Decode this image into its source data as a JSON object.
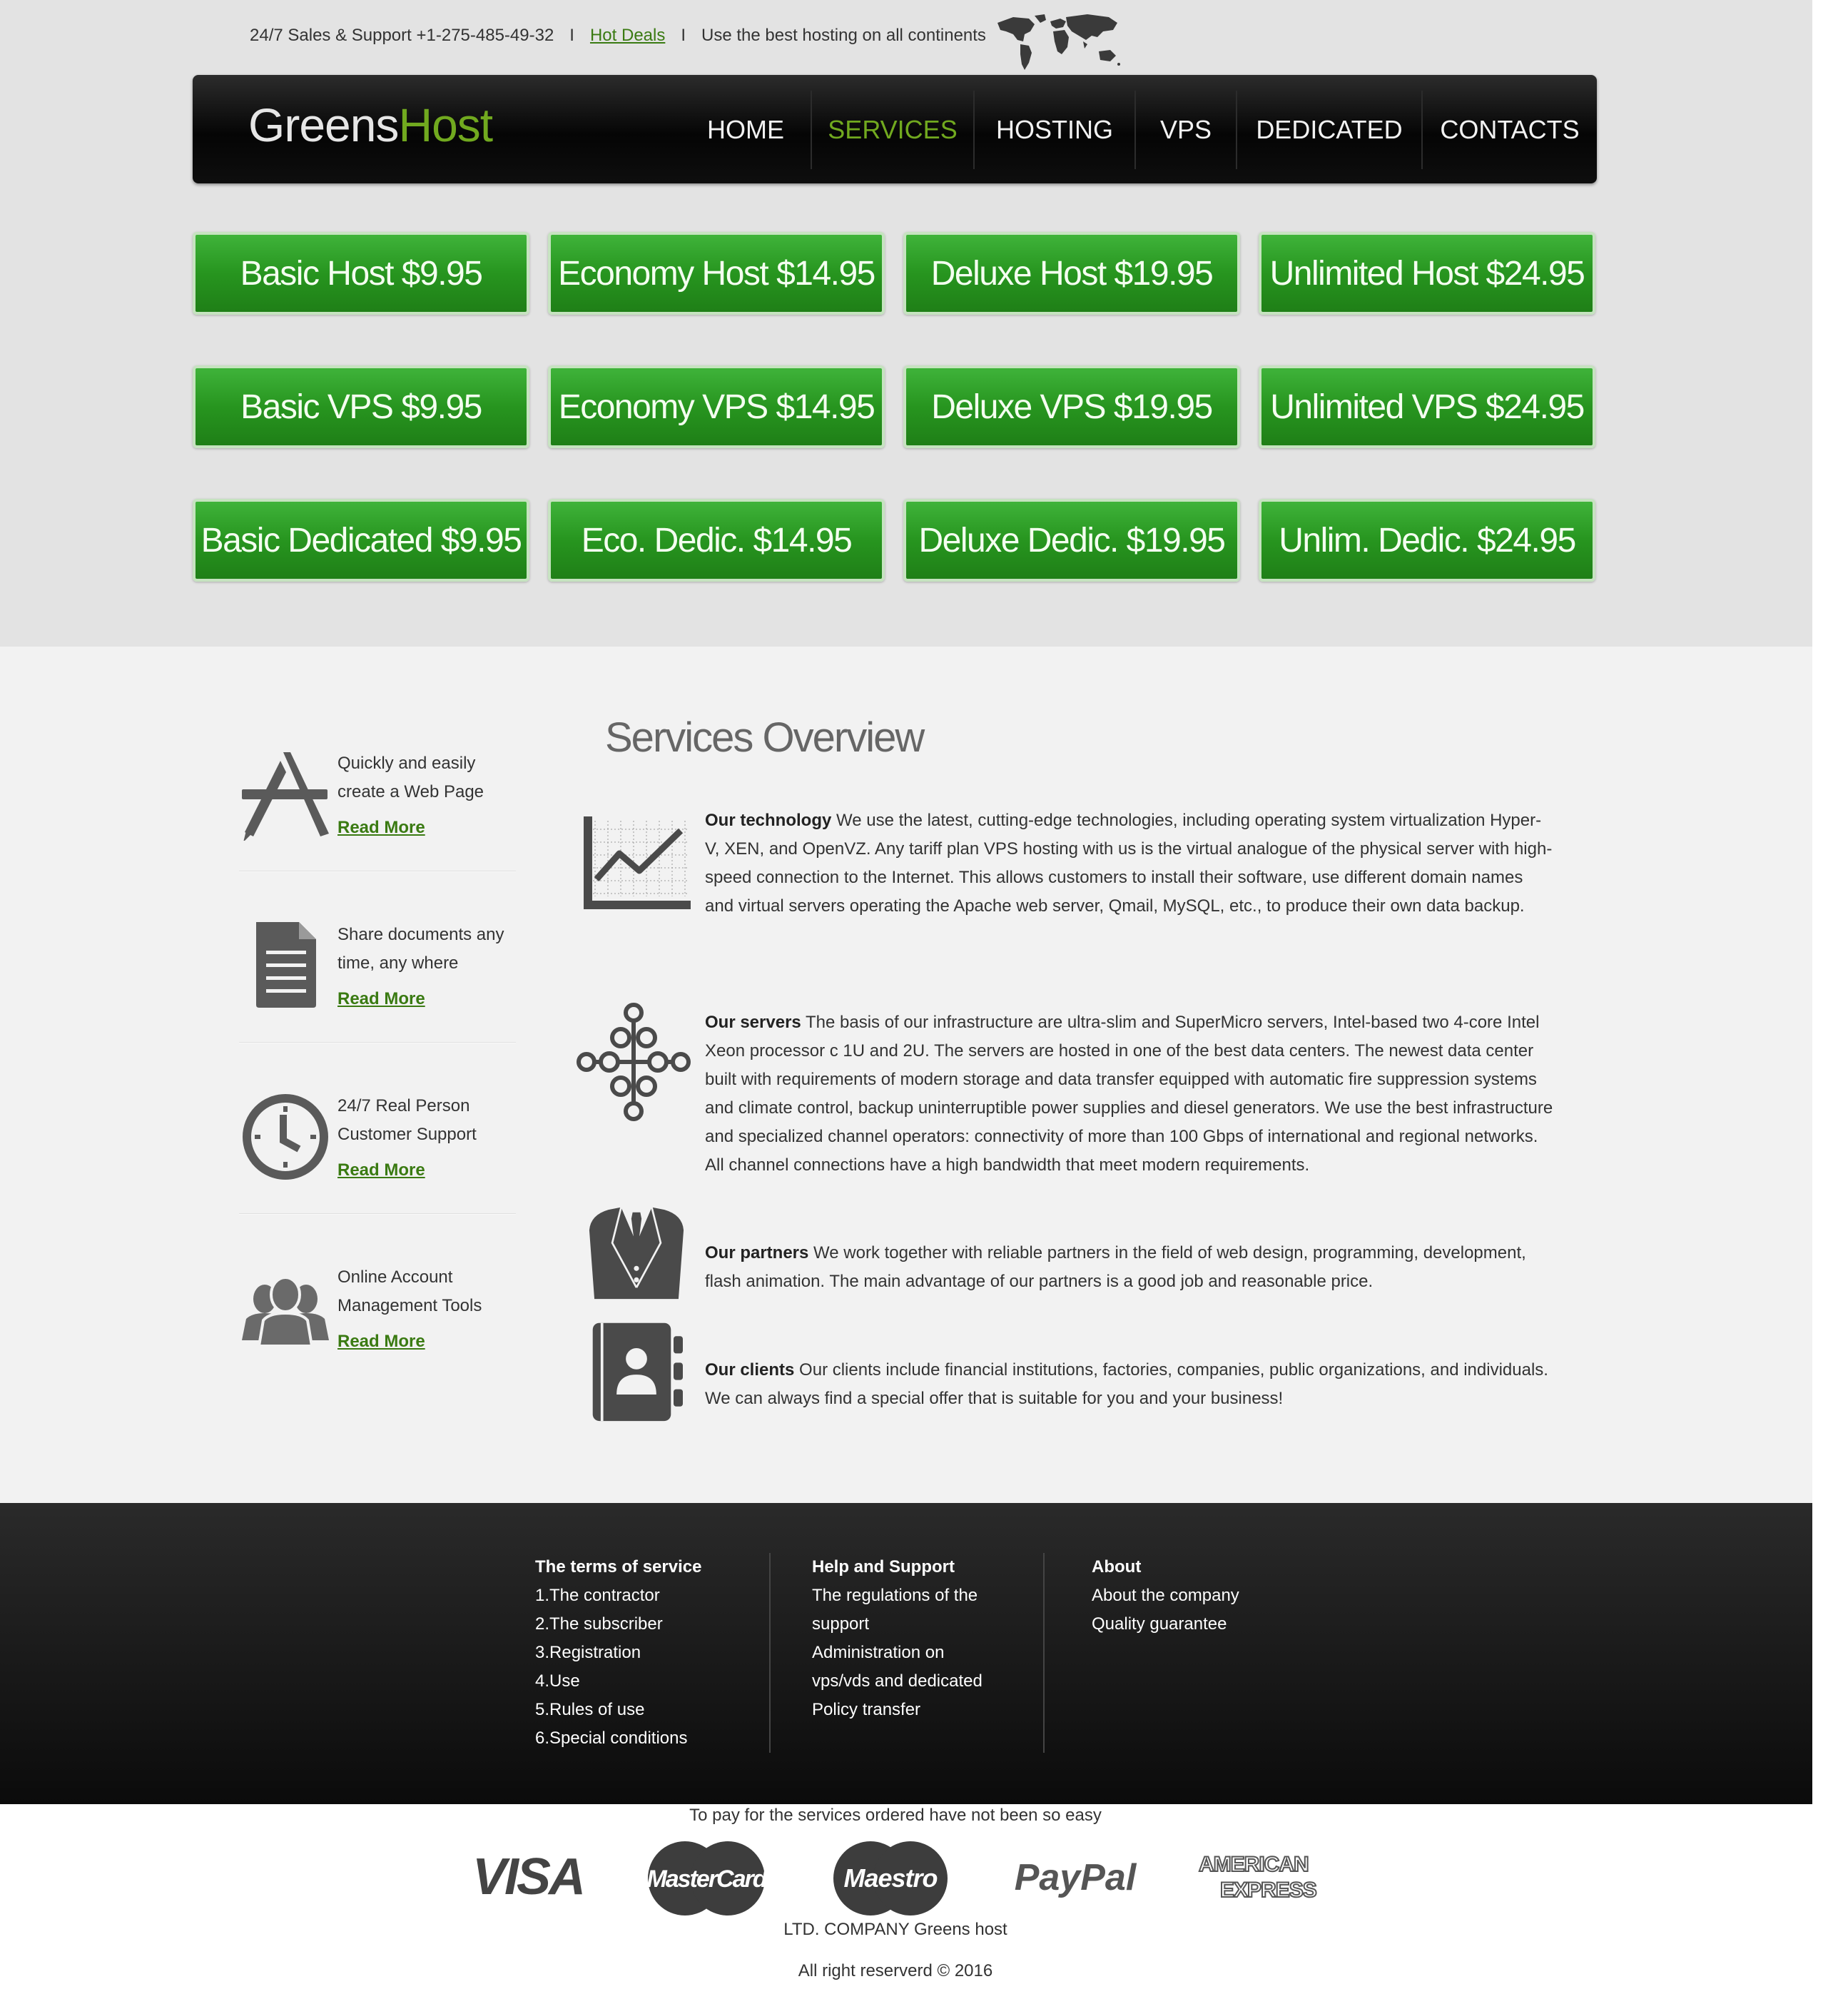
{
  "topbar": {
    "support": "24/7 Sales & Support +1-275-485-49-32",
    "sep1": "I",
    "hot_deals": "Hot Deals",
    "sep2": "I",
    "tagline": "Use the best hosting on all continents"
  },
  "logo": {
    "part1": "Greens",
    "part2": "Host"
  },
  "nav": {
    "items": [
      "HOME",
      "SERVICES",
      "HOSTING",
      "VPS",
      "DEDICATED",
      "CONTACTS"
    ],
    "active": "SERVICES"
  },
  "plans": [
    [
      "Basic Host $9.95",
      "Economy Host $14.95",
      "Deluxe Host $19.95",
      "Unlimited Host $24.95"
    ],
    [
      "Basic VPS $9.95",
      "Economy VPS $14.95",
      "Deluxe VPS $19.95",
      "Unlimited VPS $24.95"
    ],
    [
      "Basic Dedicated $9.95",
      "Eco. Dedic. $14.95",
      "Deluxe Dedic. $19.95",
      "Unlim. Dedic. $24.95"
    ]
  ],
  "features": [
    {
      "icon": "app-store-icon",
      "text": "Quickly and easily create a Web Page",
      "link": "Read More"
    },
    {
      "icon": "document-icon",
      "text": "Share documents any time, any where",
      "link": "Read More"
    },
    {
      "icon": "clock-icon",
      "text": "24/7 Real Person Customer Support",
      "link": "Read More"
    },
    {
      "icon": "users-icon",
      "text": "Online Account Management Tools",
      "link": "Read More"
    }
  ],
  "overview": {
    "title": "Services Overview",
    "blocks": [
      {
        "icon": "chart-icon",
        "heading": "Our technology",
        "text": "We use the latest, cutting-edge technologies, including operating system virtualization Hyper-V, XEN, and OpenVZ. Any tariff plan VPS hosting with us is the virtual analogue of the physical server with high-speed connection to the Internet. This allows customers to install their software, use different domain names and virtual servers operating the Apache web server, Qmail, MySQL, etc., to produce their own data backup."
      },
      {
        "icon": "network-icon",
        "heading": "Our servers",
        "text": "The basis of our infrastructure are ultra-slim and SuperMicro servers, Intel-based two 4-core Intel Xeon processor c 1U and 2U. The servers are hosted in one of the best data centers. The newest data center built with requirements of modern storage and data transfer equipped with automatic fire suppression systems and climate control, backup uninterruptible power supplies and diesel generators. We use the best infrastructure and specialized channel operators: connectivity of more than 100 Gbps of international and regional networks. All channel connections have a high bandwidth that meet modern requirements."
      },
      {
        "icon": "suit-icon",
        "heading": "Our partners",
        "text": "We work together with reliable partners in the field of web design, programming, development, flash animation. The main advantage of our partners is a good job and reasonable price."
      },
      {
        "icon": "contacts-book-icon",
        "heading": "Our clients",
        "text": "Our clients include financial institutions, factories, companies, public organizations, and individuals. We can always find a special offer that is suitable for you and your business!"
      }
    ]
  },
  "footer": {
    "terms": {
      "heading": "The terms of service",
      "items": [
        "1.The contractor",
        "2.The subscriber",
        "3.Registration",
        "4.Use",
        "5.Rules of use",
        "6.Special conditions"
      ]
    },
    "help": {
      "heading": "Help and Support",
      "items": [
        "The regulations of the support",
        "Administration on vps/vds and dedicated",
        "Policy transfer"
      ]
    },
    "about": {
      "heading": "About",
      "items": [
        "About the company",
        "Quality guarantee"
      ]
    }
  },
  "payment": {
    "note": "To pay for the services ordered have not been so easy",
    "cards": [
      "VISA",
      "MasterCard",
      "Maestro",
      "PayPal",
      "AMERICAN",
      "EXPRESS"
    ]
  },
  "company": "LTD. COMPANY Greens host",
  "copyright": "All right reserverd © 2016",
  "colors": {
    "brand_green": "#71a91f",
    "button_green": "#2a9a22",
    "link_green": "#3a7a12",
    "footer_bg": "#1a1a1a"
  }
}
